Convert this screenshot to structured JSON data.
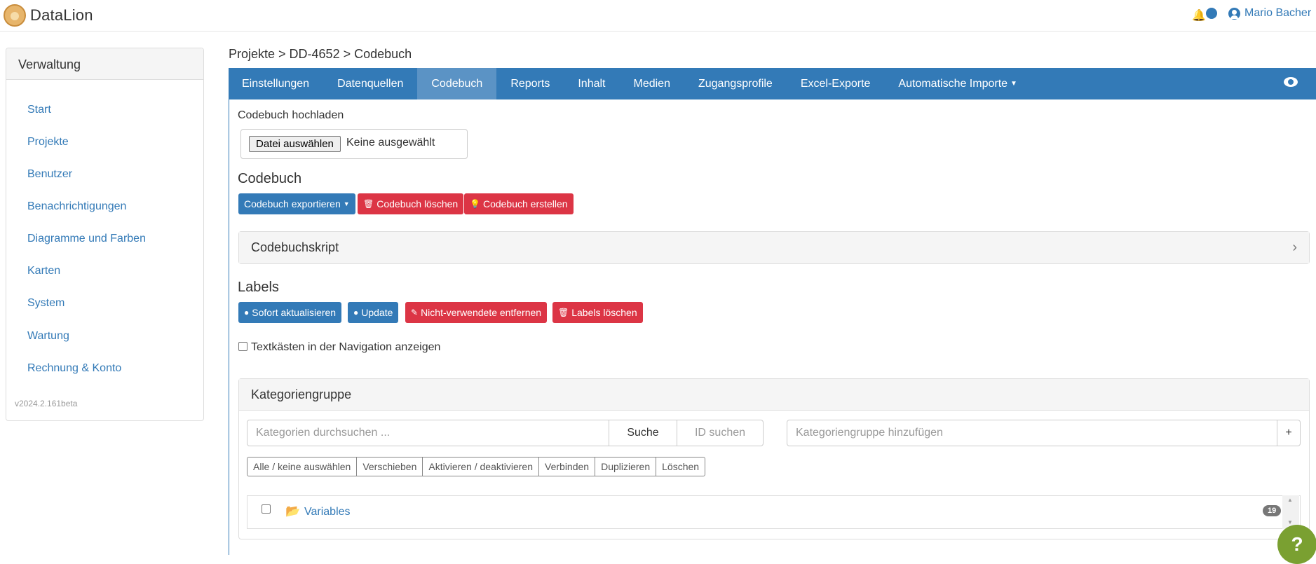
{
  "app": {
    "name": "DataLion"
  },
  "header": {
    "user_name": "Mario Bacher"
  },
  "sidebar": {
    "title": "Verwaltung",
    "items": [
      {
        "label": "Start"
      },
      {
        "label": "Projekte"
      },
      {
        "label": "Benutzer"
      },
      {
        "label": "Benachrichtigungen"
      },
      {
        "label": "Diagramme und Farben"
      },
      {
        "label": "Karten"
      },
      {
        "label": "System"
      },
      {
        "label": "Wartung"
      },
      {
        "label": "Rechnung & Konto"
      }
    ],
    "version": "v2024.2.161beta"
  },
  "breadcrumb": "Projekte > DD-4652 > Codebuch",
  "tabs": [
    {
      "label": "Einstellungen"
    },
    {
      "label": "Datenquellen"
    },
    {
      "label": "Codebuch",
      "active": true
    },
    {
      "label": "Reports"
    },
    {
      "label": "Inhalt"
    },
    {
      "label": "Medien"
    },
    {
      "label": "Zugangsprofile"
    },
    {
      "label": "Excel-Exporte"
    },
    {
      "label": "Automatische Importe"
    }
  ],
  "upload": {
    "label": "Codebuch hochladen",
    "button": "Datei auswählen",
    "status": "Keine ausgewählt"
  },
  "codebuch": {
    "title": "Codebuch",
    "export": "Codebuch exportieren",
    "delete": "Codebuch löschen",
    "create": "Codebuch erstellen"
  },
  "script_panel": {
    "title": "Codebuchskript"
  },
  "labels": {
    "title": "Labels",
    "refresh_now": "Sofort aktualisieren",
    "update": "Update",
    "remove_unused": "Nicht-verwendete entfernen",
    "delete": "Labels löschen"
  },
  "textbox_option": "Textkästen in der Navigation anzeigen",
  "category_panel": {
    "title": "Kategoriengruppe",
    "search_placeholder": "Kategorien durchsuchen ...",
    "search_button": "Suche",
    "id_search": "ID suchen",
    "add_placeholder": "Kategoriengruppe hinzufügen",
    "add_button": "+",
    "actions": [
      "Alle / keine auswählen",
      "Verschieben",
      "Aktivieren / deaktivieren",
      "Verbinden",
      "Duplizieren",
      "Löschen"
    ],
    "group": {
      "name": "Variables",
      "count": "19"
    }
  },
  "help": "?",
  "colors": {
    "primary": "#337ab7",
    "danger": "#dc3545",
    "help": "#7aa031"
  }
}
